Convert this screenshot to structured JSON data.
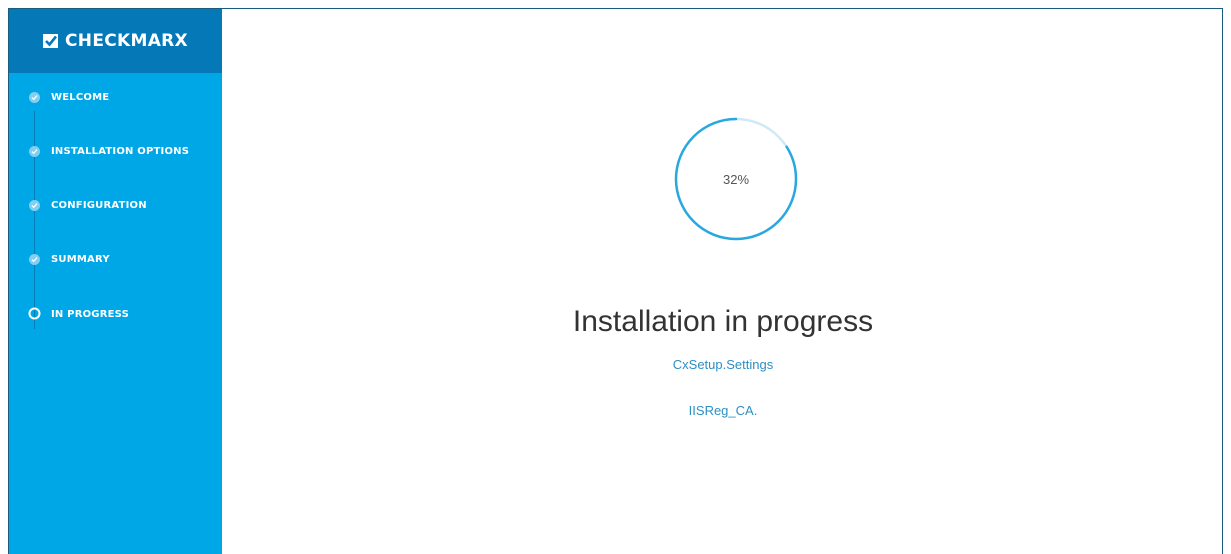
{
  "brand": {
    "name": "CHECKMARX",
    "icon": "checkmark-logo-icon"
  },
  "steps": [
    {
      "label": "WELCOME",
      "state": "done"
    },
    {
      "label": "INSTALLATION OPTIONS",
      "state": "done"
    },
    {
      "label": "CONFIGURATION",
      "state": "done"
    },
    {
      "label": "SUMMARY",
      "state": "done"
    },
    {
      "label": "IN PROGRESS",
      "state": "current"
    }
  ],
  "progress": {
    "percent": 32,
    "label": "32%"
  },
  "main": {
    "title": "Installation in progress",
    "status_line_1": "CxSetup.Settings",
    "status_line_2": "IISReg_CA."
  },
  "colors": {
    "sidebar": "#00a7e6",
    "brand_bar": "#0579b8",
    "accent": "#29a8df",
    "ring_track": "#cfe9f6",
    "link_text": "#2e8fc4"
  }
}
